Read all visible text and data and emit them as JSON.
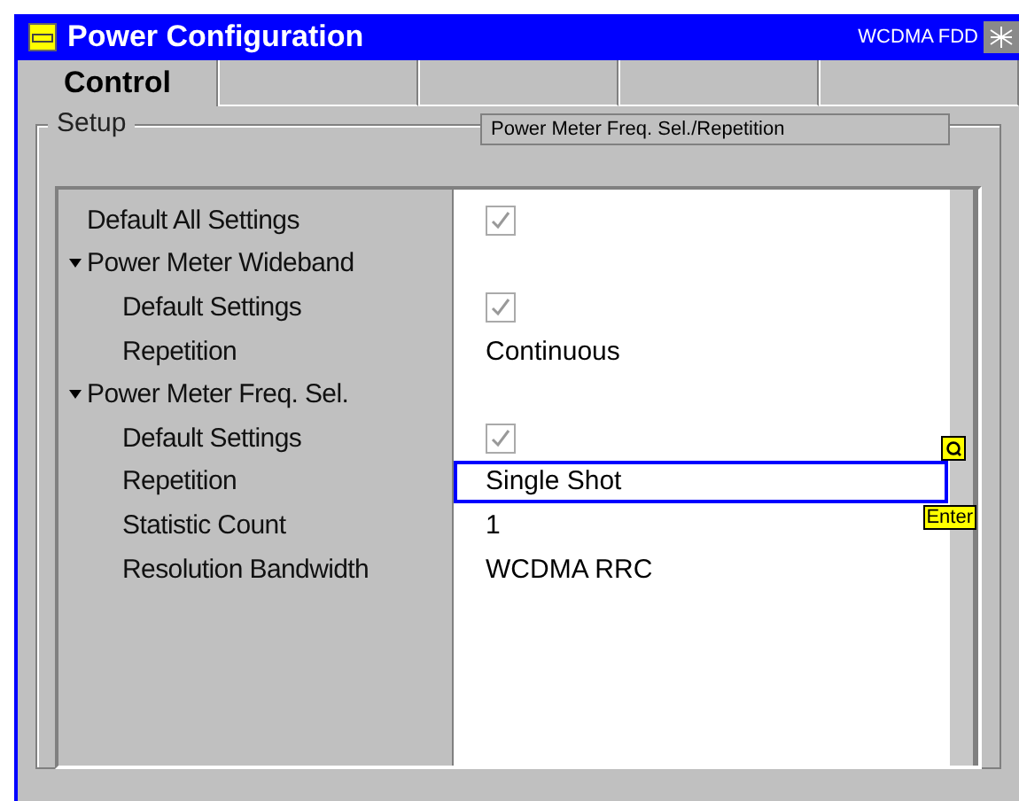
{
  "window": {
    "title": "Power Configuration",
    "mode": "WCDMA FDD"
  },
  "tabs": [
    {
      "label": "Control",
      "selected": true
    },
    {
      "selected": false
    },
    {
      "selected": false
    },
    {
      "selected": false
    },
    {
      "selected": false
    }
  ],
  "group": {
    "title": "Setup",
    "path": "Power Meter Freq. Sel./Repetition"
  },
  "tree": [
    {
      "label": "Default All Settings",
      "selected": false,
      "value": {
        "kind": "checkbox",
        "checked": true
      }
    },
    {
      "label": "Power Meter Wideband",
      "expanded": true,
      "selected": false,
      "children": [
        {
          "label": "Default Settings",
          "selected": false,
          "value": {
            "kind": "checkbox",
            "checked": true
          }
        },
        {
          "label": "Repetition",
          "selected": false,
          "value": {
            "kind": "text",
            "text": "Continuous"
          }
        }
      ]
    },
    {
      "label": "Power Meter Freq. Sel.",
      "expanded": true,
      "selected": false,
      "children": [
        {
          "label": "Default Settings",
          "selected": false,
          "value": {
            "kind": "checkbox",
            "checked": true
          }
        },
        {
          "label": "Repetition",
          "selected": true,
          "value": {
            "kind": "text",
            "text": "Single Shot"
          }
        },
        {
          "label": "Statistic Count",
          "selected": false,
          "value": {
            "kind": "text",
            "text": "1"
          }
        },
        {
          "label": "Resolution Bandwidth",
          "selected": false,
          "value": {
            "kind": "text",
            "text": "WCDMA RRC"
          }
        }
      ]
    }
  ],
  "enter_badge": "Enter"
}
